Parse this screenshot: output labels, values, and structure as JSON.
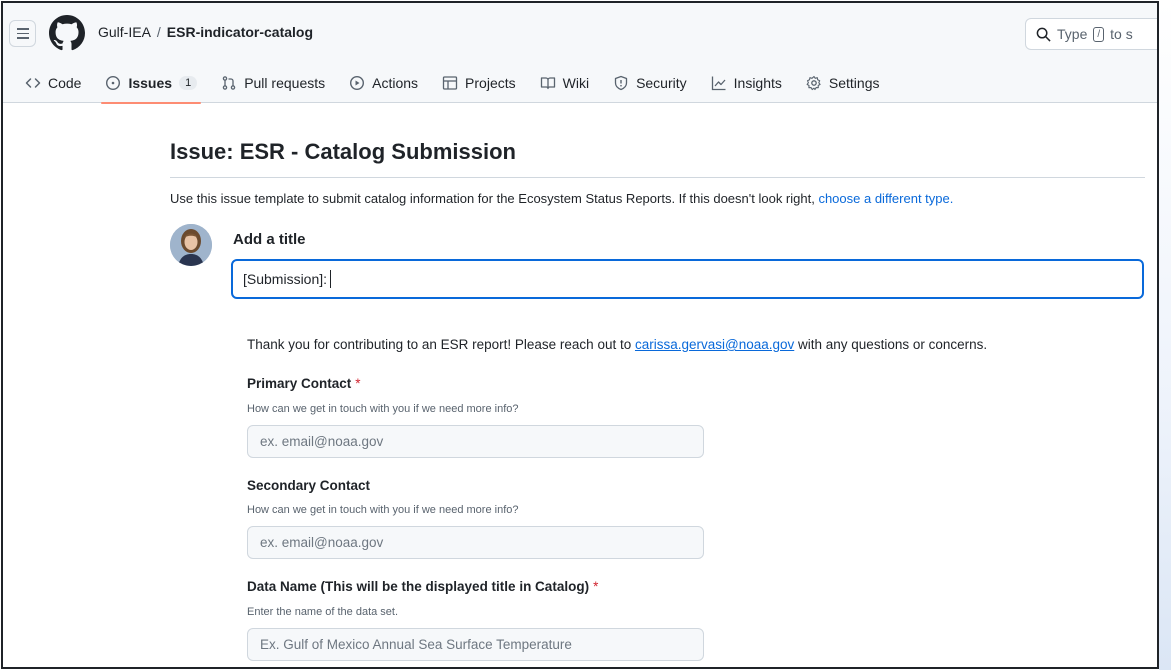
{
  "header": {
    "owner": "Gulf-IEA",
    "separator": "/",
    "repo": "ESR-indicator-catalog",
    "search_prefix": "Type",
    "search_key": "/",
    "search_suffix": "to s"
  },
  "tabs": [
    {
      "label": "Code",
      "icon": "code-icon"
    },
    {
      "label": "Issues",
      "icon": "issue-opened-icon",
      "count": "1",
      "active": true
    },
    {
      "label": "Pull requests",
      "icon": "git-pull-request-icon"
    },
    {
      "label": "Actions",
      "icon": "play-icon"
    },
    {
      "label": "Projects",
      "icon": "table-icon"
    },
    {
      "label": "Wiki",
      "icon": "book-icon"
    },
    {
      "label": "Security",
      "icon": "shield-icon"
    },
    {
      "label": "Insights",
      "icon": "graph-icon"
    },
    {
      "label": "Settings",
      "icon": "gear-icon"
    }
  ],
  "issue": {
    "heading": "Issue: ESR - Catalog Submission",
    "intro_text": "Use this issue template to submit catalog information for the Ecosystem Status Reports. If this doesn't look right, ",
    "intro_link": "choose a different type.",
    "add_title_label": "Add a title",
    "title_value": "[Submission]: "
  },
  "form": {
    "thanks_prefix": "Thank you for contributing to an ESR report! Please reach out to ",
    "thanks_email": "carissa.gervasi@noaa.gov",
    "thanks_suffix": " with any questions or concerns.",
    "required_mark": "*",
    "fields": [
      {
        "label": "Primary Contact",
        "required": true,
        "help": "How can we get in touch with you if we need more info?",
        "placeholder": "ex. email@noaa.gov"
      },
      {
        "label": "Secondary Contact",
        "required": false,
        "help": "How can we get in touch with you if we need more info?",
        "placeholder": "ex. email@noaa.gov"
      },
      {
        "label": "Data Name (This will be the displayed title in Catalog)",
        "required": true,
        "help": "Enter the name of the data set.",
        "placeholder": "Ex. Gulf of Mexico Annual Sea Surface Temperature"
      }
    ]
  },
  "colors": {
    "accent": "#0969da",
    "tab_underline": "#fd8c73",
    "required": "#d1242f"
  }
}
